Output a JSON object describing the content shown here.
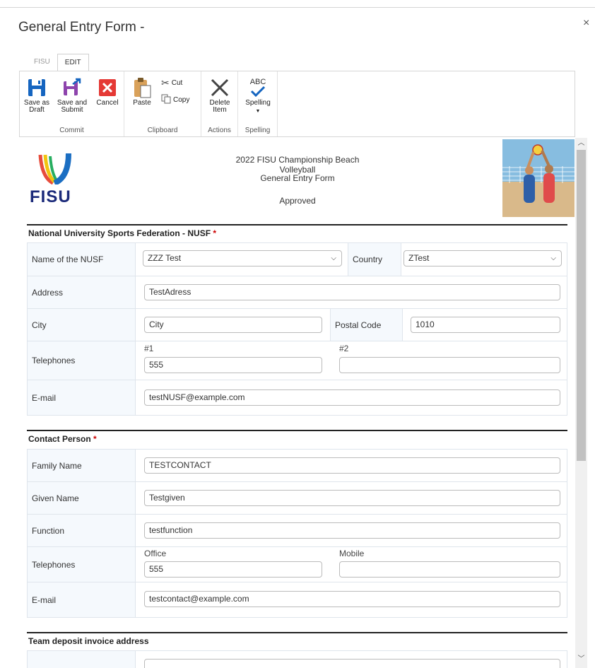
{
  "dialog": {
    "title": "General Entry Form -",
    "close_glyph": "×"
  },
  "ribbon": {
    "tabs": [
      "FISU",
      "EDIT"
    ],
    "commit": {
      "label": "Commit",
      "save_draft": "Save as\nDraft",
      "save_submit": "Save and\nSubmit",
      "cancel": "Cancel"
    },
    "clipboard": {
      "label": "Clipboard",
      "paste": "Paste",
      "cut": "Cut",
      "copy": "Copy"
    },
    "actions": {
      "label": "Actions",
      "delete": "Delete\nItem"
    },
    "spelling": {
      "label": "Spelling",
      "spelling": "Spelling",
      "abc": "ABC"
    }
  },
  "header": {
    "logo_text": "FISU",
    "event": "2022 FISU Championship Beach Volleyball",
    "form_name": "General Entry Form",
    "status": "Approved"
  },
  "nusf": {
    "title": "National University Sports Federation - NUSF",
    "required": "*",
    "name_label": "Name of the NUSF",
    "name_value": "ZZZ Test",
    "country_label": "Country",
    "country_value": "ZTest",
    "address_label": "Address",
    "address_value": "TestAdress",
    "city_label": "City",
    "city_value": "City",
    "postal_label": "Postal Code",
    "postal_value": "1010",
    "tel_label": "Telephones",
    "tel1_label": "#1",
    "tel1_value": "555",
    "tel2_label": "#2",
    "tel2_value": "",
    "email_label": "E-mail",
    "email_value": "testNUSF@example.com"
  },
  "contact": {
    "title": "Contact Person",
    "required": "*",
    "family_label": "Family Name",
    "family_value": "TESTCONTACT",
    "given_label": "Given Name",
    "given_value": "Testgiven",
    "function_label": "Function",
    "function_value": "testfunction",
    "tel_label": "Telephones",
    "office_label": "Office",
    "office_value": "555",
    "mobile_label": "Mobile",
    "mobile_value": "",
    "email_label": "E-mail",
    "email_value": "testcontact@example.com"
  },
  "invoice": {
    "title": "Team deposit invoice address"
  },
  "colors": {
    "brand": "#1b2a7a",
    "required": "#cc0000",
    "save_blue": "#1565c0",
    "cancel_red": "#e53935"
  }
}
